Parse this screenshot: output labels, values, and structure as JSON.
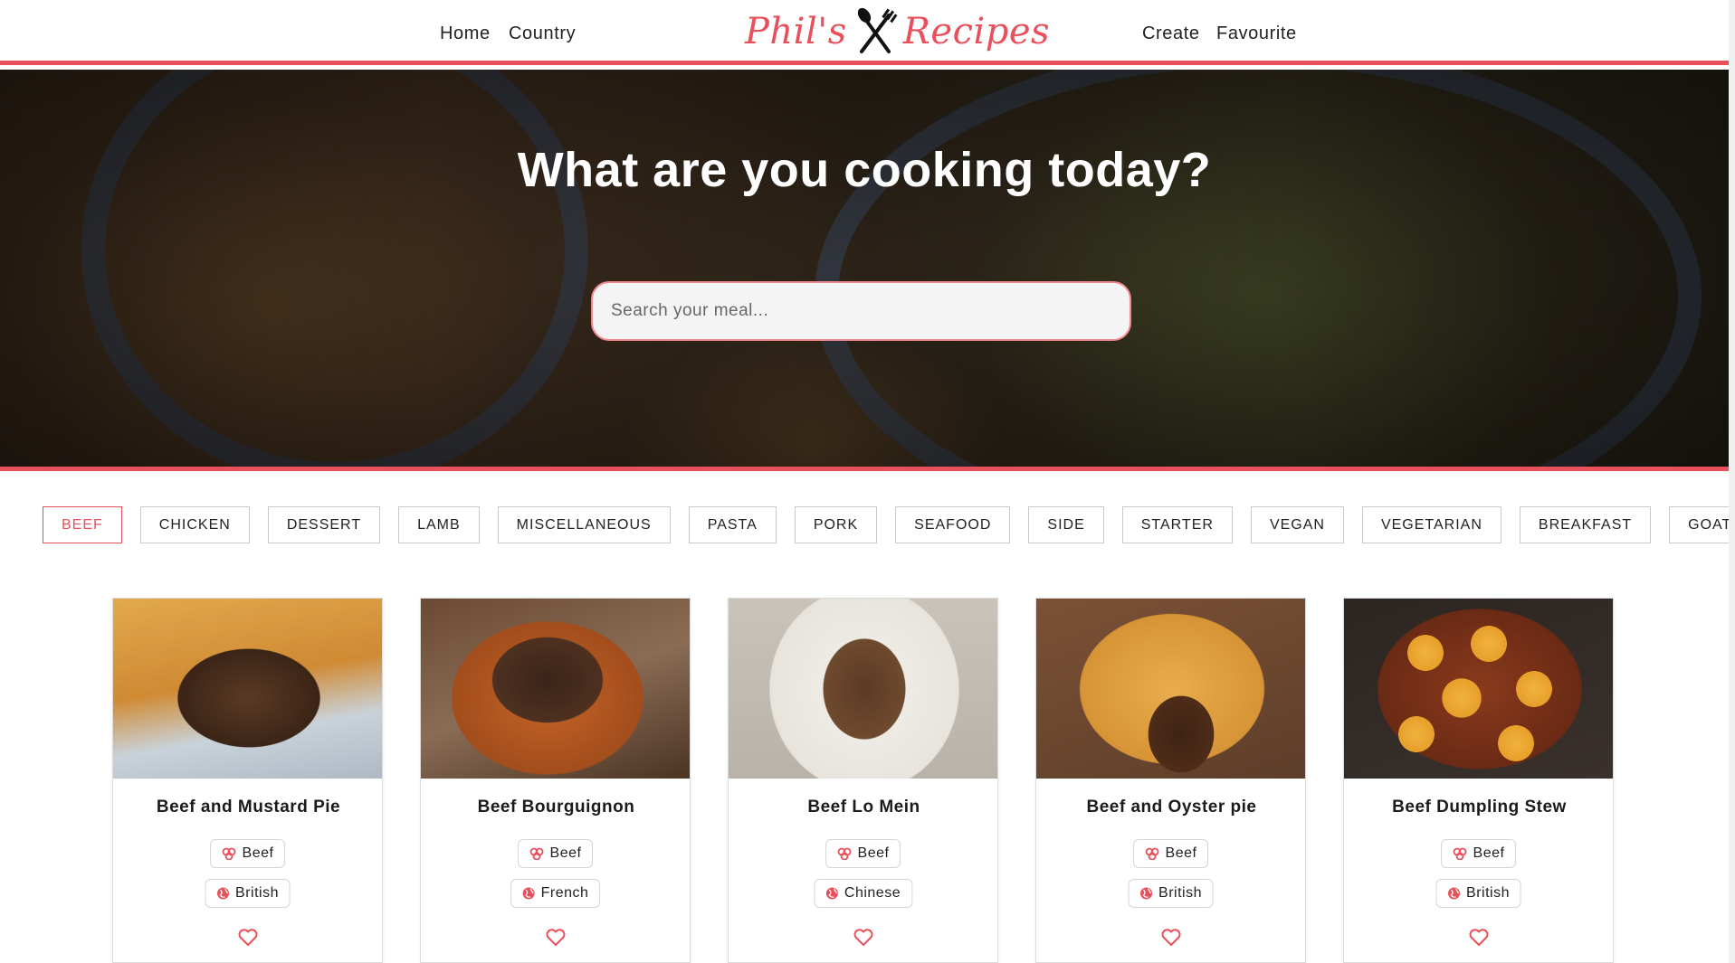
{
  "nav": {
    "left": [
      "Home",
      "Country"
    ],
    "right": [
      "Create",
      "Favourite"
    ],
    "logo_left": "Phil's",
    "logo_right": "Recipes",
    "logo_icon": "fork-knife-icon"
  },
  "hero": {
    "title": "What are you cooking today?",
    "search_placeholder": "Search your meal..."
  },
  "categories": {
    "items": [
      "BEEF",
      "CHICKEN",
      "DESSERT",
      "LAMB",
      "MISCELLANEOUS",
      "PASTA",
      "PORK",
      "SEAFOOD",
      "SIDE",
      "STARTER",
      "VEGAN",
      "VEGETARIAN",
      "BREAKFAST",
      "GOAT"
    ],
    "selected": "BEEF"
  },
  "recipes": [
    {
      "title": "Beef and Mustard Pie",
      "category": "Beef",
      "area": "British"
    },
    {
      "title": "Beef Bourguignon",
      "category": "Beef",
      "area": "French"
    },
    {
      "title": "Beef Lo Mein",
      "category": "Beef",
      "area": "Chinese"
    },
    {
      "title": "Beef and Oyster pie",
      "category": "Beef",
      "area": "British"
    },
    {
      "title": "Beef Dumpling Stew",
      "category": "Beef",
      "area": "British"
    }
  ],
  "icons": {
    "category": "ingredient-icon",
    "area": "globe-icon",
    "favourite": "heart-outline-icon"
  },
  "colors": {
    "accent": "#e8505b",
    "text": "#222222",
    "border": "#c9c9c9"
  }
}
